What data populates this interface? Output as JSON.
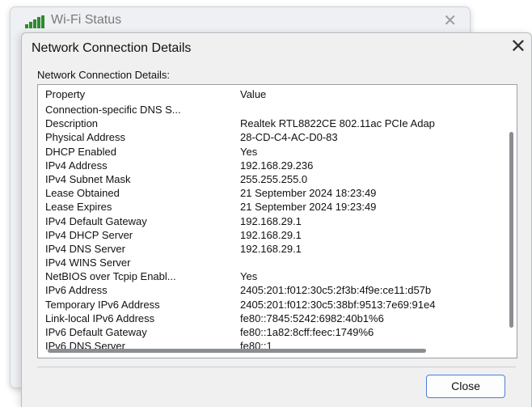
{
  "background_window": {
    "title": "Wi-Fi Status",
    "close_glyph": "✕",
    "icon": "wifi-signal-icon"
  },
  "dialog": {
    "title": "Network Connection Details",
    "close_glyph": "✕",
    "group_label": "Network Connection Details:",
    "columns": {
      "property": "Property",
      "value": "Value"
    },
    "rows": [
      {
        "property": "Connection-specific DNS S...",
        "value": ""
      },
      {
        "property": "Description",
        "value": "Realtek RTL8822CE 802.11ac PCIe Adap"
      },
      {
        "property": "Physical Address",
        "value": "28-CD-C4-AC-D0-83"
      },
      {
        "property": "DHCP Enabled",
        "value": "Yes"
      },
      {
        "property": "IPv4 Address",
        "value": "192.168.29.236"
      },
      {
        "property": "IPv4 Subnet Mask",
        "value": "255.255.255.0"
      },
      {
        "property": "Lease Obtained",
        "value": "21 September 2024 18:23:49"
      },
      {
        "property": "Lease Expires",
        "value": "21 September 2024 19:23:49"
      },
      {
        "property": "IPv4 Default Gateway",
        "value": "192.168.29.1"
      },
      {
        "property": "IPv4 DHCP Server",
        "value": "192.168.29.1"
      },
      {
        "property": "IPv4 DNS Server",
        "value": "192.168.29.1"
      },
      {
        "property": "IPv4 WINS Server",
        "value": ""
      },
      {
        "property": "NetBIOS over Tcpip Enabl...",
        "value": "Yes"
      },
      {
        "property": "IPv6 Address",
        "value": "2405:201:f012:30c5:2f3b:4f9e:ce11:d57b"
      },
      {
        "property": "Temporary IPv6 Address",
        "value": "2405:201:f012:30c5:38bf:9513:7e69:91e4"
      },
      {
        "property": "Link-local IPv6 Address",
        "value": "fe80::7845:5242:6982:40b1%6"
      },
      {
        "property": "IPv6 Default Gateway",
        "value": "fe80::1a82:8cff:feec:1749%6"
      },
      {
        "property": "IPv6 DNS Server",
        "value": "fe80::1"
      }
    ],
    "close_button_label": "Close"
  },
  "colors": {
    "accent_border": "#4a7fd6",
    "wifi_icon": "#2e8b2e"
  }
}
